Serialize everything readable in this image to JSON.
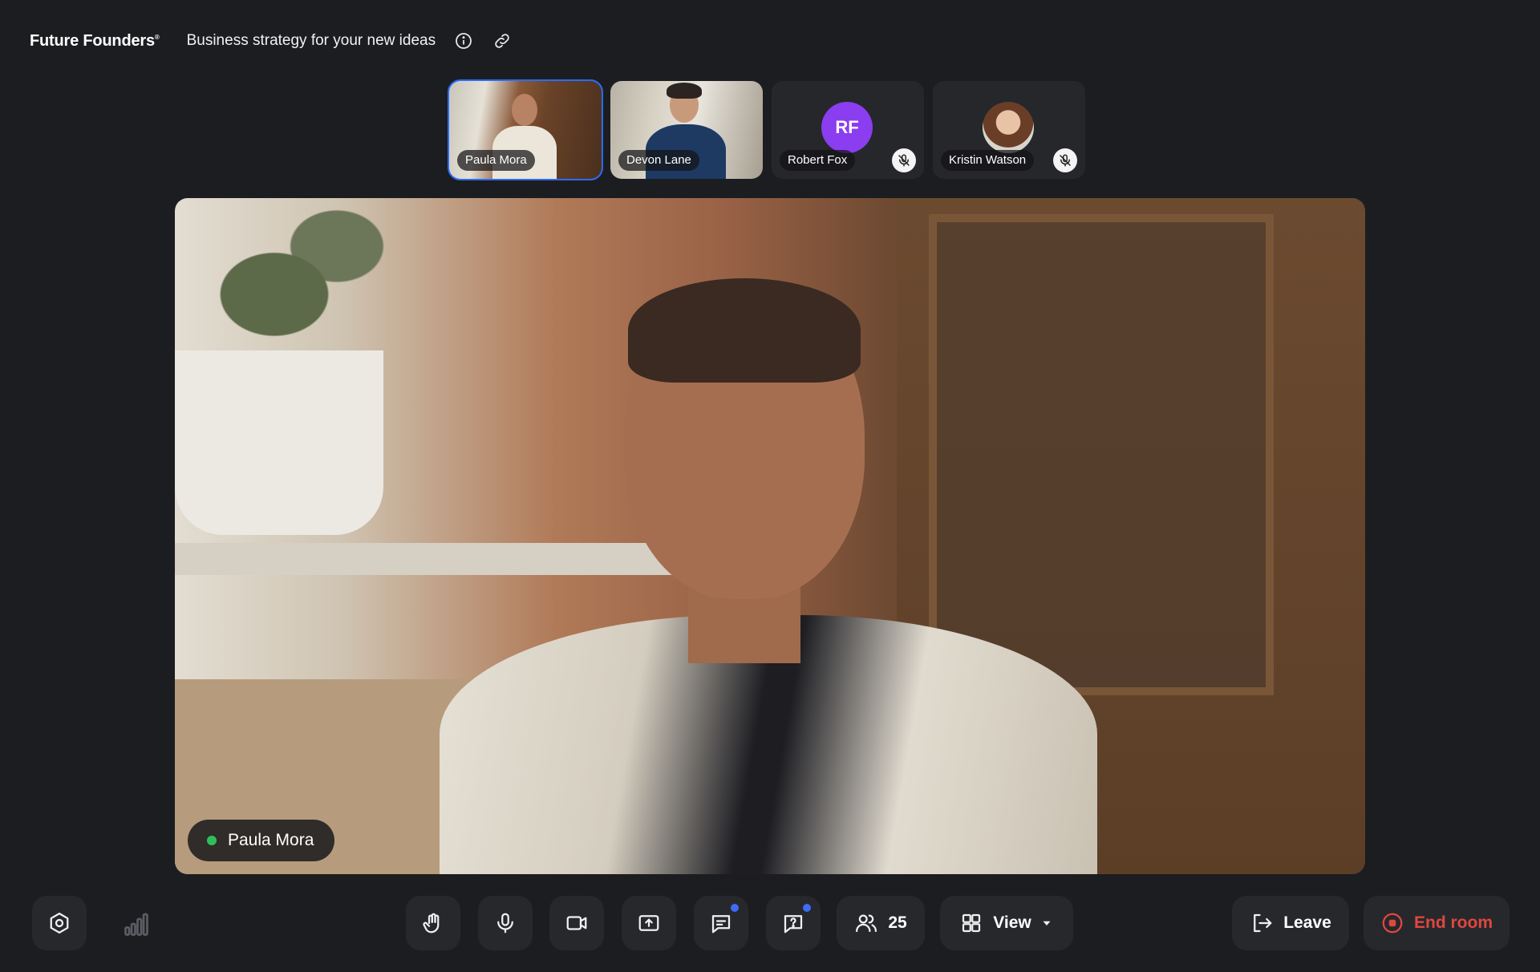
{
  "header": {
    "brand": "Future Founders",
    "brand_mark": "®",
    "meeting_title": "Business strategy for your new ideas"
  },
  "participants": [
    {
      "name": "Paula Mora",
      "active": true,
      "video": true
    },
    {
      "name": "Devon Lane",
      "active": false,
      "video": true
    },
    {
      "name": "Robert Fox",
      "initials": "RF",
      "muted": true,
      "avatar_color": "#8b3df0"
    },
    {
      "name": "Kristin Watson",
      "muted": true
    }
  ],
  "main_speaker": {
    "name": "Paula Mora",
    "status_color": "#2fbf5a"
  },
  "toolbar": {
    "participants_count": "25",
    "view_label": "View",
    "leave_label": "Leave",
    "end_room_label": "End room"
  },
  "colors": {
    "accent": "#2a6cf5",
    "badge": "#3f6cf6",
    "danger": "#e0473f",
    "background": "#1c1d20",
    "button_bg": "#26282c"
  }
}
